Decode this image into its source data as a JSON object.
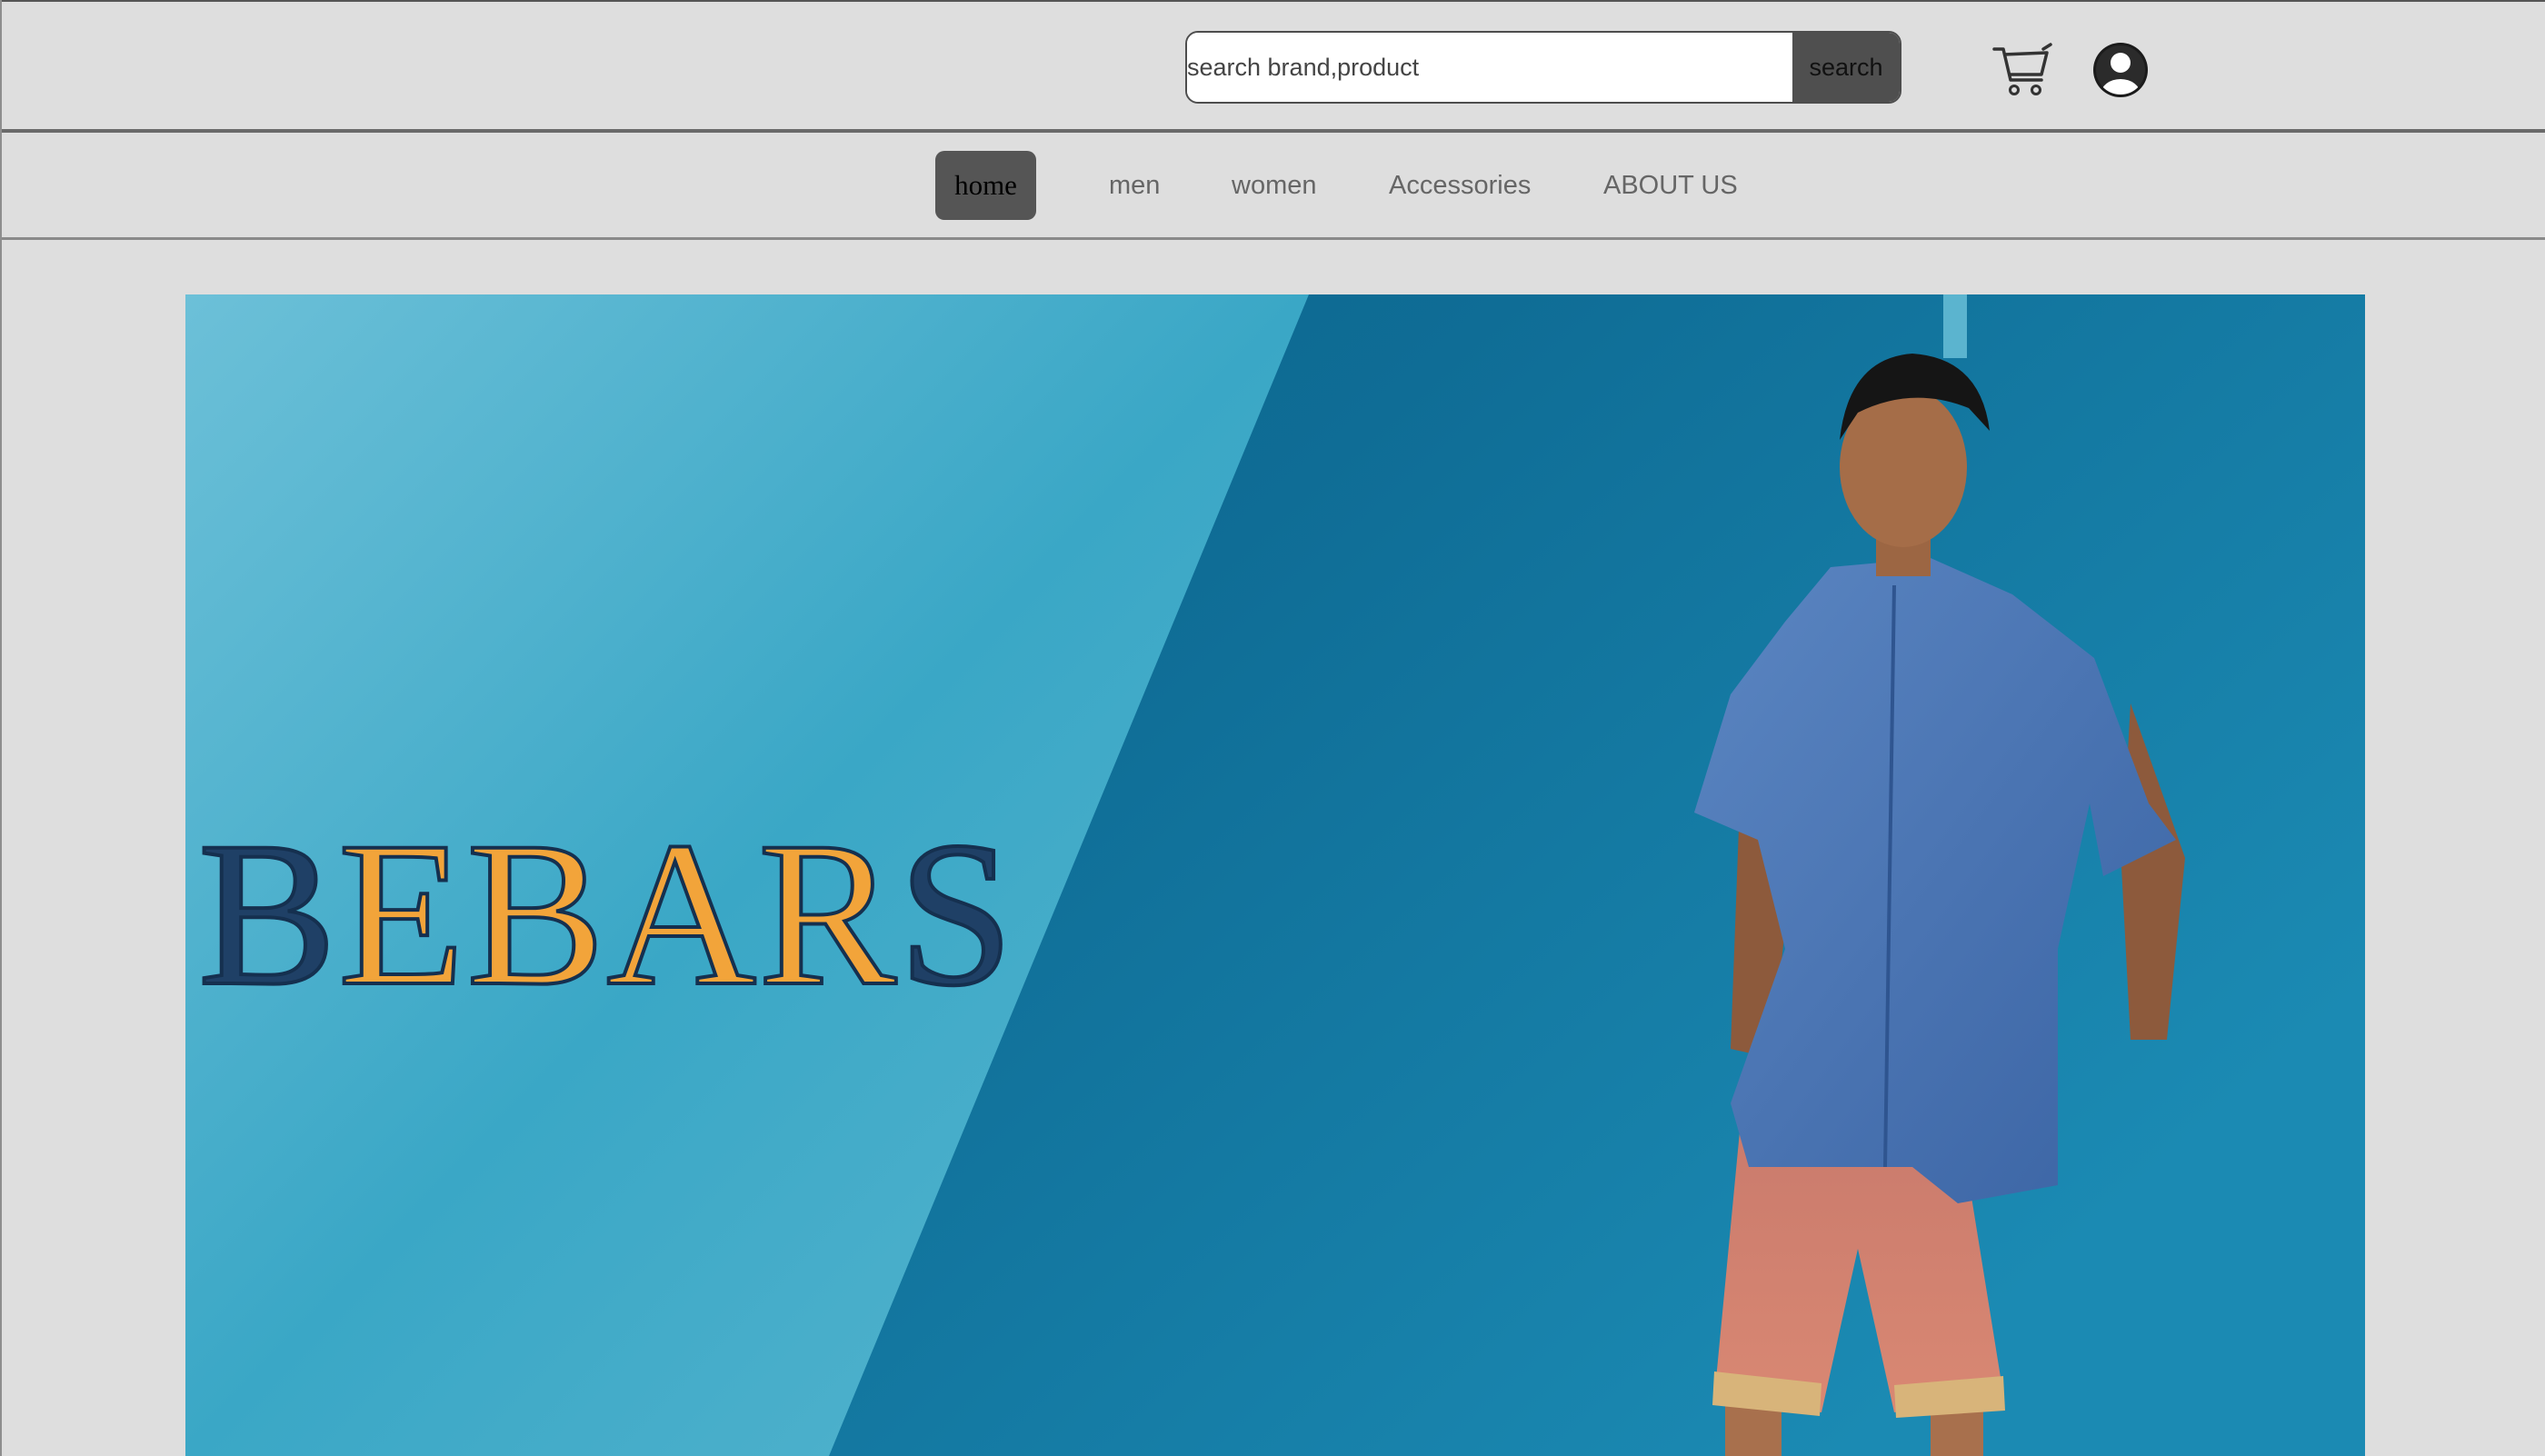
{
  "header": {
    "search": {
      "placeholder": "search brand,product",
      "value": "",
      "button_label": "search"
    },
    "icons": [
      "cart-icon",
      "user-account-icon"
    ]
  },
  "nav": {
    "items": [
      {
        "label": "home",
        "active": true
      },
      {
        "label": "men",
        "active": false
      },
      {
        "label": "women",
        "active": false
      },
      {
        "label": "Accessories",
        "active": false
      },
      {
        "label": "ABOUT US",
        "active": false
      }
    ]
  },
  "hero": {
    "brand_letters": [
      "B",
      "E",
      "B",
      "A",
      "R",
      "S"
    ],
    "colors": {
      "sky_blue": "#3fa9c6",
      "deep_blue": "#0e6a92",
      "logo_dark": "#1f4066",
      "logo_orange": "#f2a43a"
    }
  },
  "colors": {
    "page_background": "#dedede",
    "button_dark": "#4f4f4f",
    "nav_active": "#555555"
  }
}
